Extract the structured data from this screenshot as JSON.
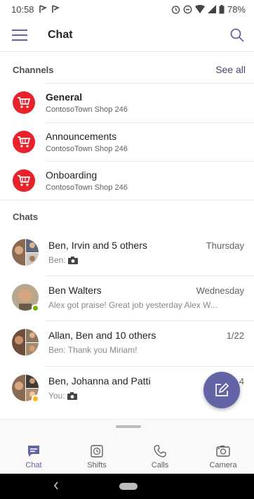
{
  "status_bar": {
    "time": "10:58",
    "battery": "78%",
    "icons": [
      "notification-flag-icon",
      "notification-flag-icon",
      "alarm-icon",
      "do-not-disturb-icon",
      "wifi-icon",
      "signal-icon",
      "battery-icon"
    ]
  },
  "app_bar": {
    "title": "Chat",
    "icons": [
      "hamburger-menu-icon",
      "search-icon"
    ]
  },
  "channels": {
    "header": "Channels",
    "see_all": "See all",
    "items": [
      {
        "name": "General",
        "team": "ContosoTown Shop 246",
        "bold": true
      },
      {
        "name": "Announcements",
        "team": "ContosoTown Shop 246",
        "bold": false
      },
      {
        "name": "Onboarding",
        "team": "ContosoTown Shop 246",
        "bold": false
      }
    ]
  },
  "chats": {
    "header": "Chats",
    "items": [
      {
        "name": "Ben, Irvin and 5 others",
        "time": "Thursday",
        "preview": "Ben:",
        "attachment_icon": "camera-icon"
      },
      {
        "name": "Ben Walters",
        "time": "Wednesday",
        "preview": "Alex got praise!  Great job yesterday Alex W...",
        "status": "available"
      },
      {
        "name": "Allan, Ben and 10 others",
        "time": "1/22",
        "preview": "Ben: Thank you Miriam!"
      },
      {
        "name": "Ben, Johanna and Patti",
        "time": "4",
        "preview": "You:",
        "attachment_icon": "camera-icon"
      }
    ]
  },
  "fab": {
    "icon": "compose-icon"
  },
  "bottom_nav": {
    "tabs": [
      {
        "label": "Chat",
        "icon": "chat-icon",
        "active": true
      },
      {
        "label": "Shifts",
        "icon": "shifts-icon",
        "active": false
      },
      {
        "label": "Calls",
        "icon": "phone-icon",
        "active": false
      },
      {
        "label": "Camera",
        "icon": "camera-icon",
        "active": false
      }
    ]
  },
  "colors": {
    "brand": "#6264a7",
    "channel_avatar": "#e8212a",
    "available": "#6bb700"
  }
}
